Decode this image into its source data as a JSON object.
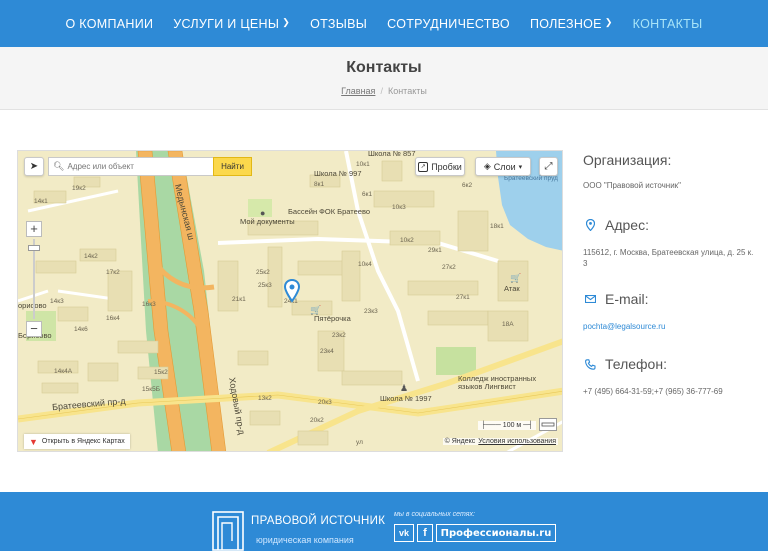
{
  "nav": {
    "items": [
      {
        "label": "О КОМПАНИИ",
        "dropdown": false,
        "active": false
      },
      {
        "label": "УСЛУГИ И ЦЕНЫ",
        "dropdown": true,
        "active": false
      },
      {
        "label": "ОТЗЫВЫ",
        "dropdown": false,
        "active": false
      },
      {
        "label": "СОТРУДНИЧЕСТВО",
        "dropdown": false,
        "active": false
      },
      {
        "label": "ПОЛЕЗНОЕ",
        "dropdown": true,
        "active": false
      },
      {
        "label": "КОНТАКТЫ",
        "dropdown": false,
        "active": true
      }
    ],
    "active_color": "#a8e4f8",
    "bg_color": "#2e8ad6"
  },
  "page": {
    "title": "Контакты",
    "breadcrumb": {
      "home": "Главная",
      "separator": "/",
      "current": "Контакты"
    }
  },
  "map": {
    "search_placeholder": "Адрес или объект",
    "find_button": "Найти",
    "traffic_button": "Пробки",
    "layers_button": "Слои",
    "open_in_yandex": "Открыть в Яндекс Картах",
    "copyright": "© Яндекс",
    "terms_link": "Условия использования",
    "scale": "100 м",
    "labels": {
      "school857": "Школа № 857",
      "school997": "Школа № 997",
      "school1997": "Школа № 1997",
      "pool": "Бассейн ФОК Братеево",
      "mydocs": "Мой документы",
      "pyaterochka": "Пятёрочка",
      "atak": "Атак",
      "college": "Колледж иностранных языков Лингвист",
      "brateevsky_pr": "Братеевский пр-д",
      "khodynsky": "Ходовый пр-д",
      "borisovo": "Борисово",
      "borisovo2": "орисово",
      "pond": "Братеевский пруд",
      "medynsk": "Медынская ш",
      "kulturn": "ул",
      "b21": "21к1",
      "b25c2": "25к2",
      "b25c3": "25к3",
      "b24c1": "24к1",
      "b16c3": "16к3",
      "b19c2": "19к2",
      "b17c2": "17к2",
      "b14c2": "14к2",
      "b15c2": "15к2",
      "b29c1": "29к1",
      "b27c2": "27к2",
      "b27c1": "27к1",
      "b23c2": "23к2",
      "b23c3": "23к3",
      "b23c4": "23к4",
      "b10c3": "10к3",
      "b10c2": "10к2",
      "b10c4": "10к4",
      "b10c1": "10к1",
      "b18a": "18А",
      "b18c1": "18к1",
      "b6c1": "6к1",
      "b6c2": "6к2",
      "b16c4": "16к4",
      "b14c1": "14к1",
      "b14c4a": "14к4А",
      "b14c6": "14к6",
      "b15s8": "15к5Б",
      "b14s3": "14к3",
      "b8c1": "8к1",
      "b8c2": "8к2",
      "b13c2": "13к2",
      "b20c3": "20к3",
      "b20c2": "20к2"
    }
  },
  "contacts": {
    "org_heading": "Организация:",
    "org_value": "ООО \"Правовой источник\"",
    "address_heading": "Адрес:",
    "address_value": "115612, г. Москва, Братеевская улица, д. 25 к. 3",
    "email_heading": "E-mail:",
    "email_value": "pochta@legalsource.ru",
    "phone_heading": "Телефон:",
    "phone_value": "+7 (495) 664-31-59;+7 (965) 36-777-69",
    "icon_color": "#2e8ad6"
  },
  "footer": {
    "brand_name": "ПРАВОВОЙ ИСТОЧНИК",
    "brand_tagline": "юридическая компания",
    "social_caption": "мы в социальных сетях:",
    "social": {
      "vk": "vk",
      "fb": "f",
      "pro": "Профессионалы.ru"
    },
    "bg_color": "#2e8ad6"
  }
}
